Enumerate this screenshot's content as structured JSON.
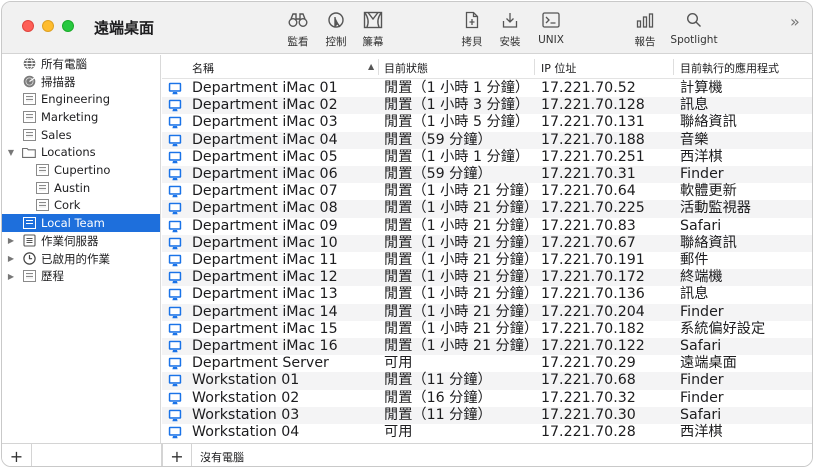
{
  "window": {
    "title": "遠端桌面"
  },
  "toolbar": {
    "buttons": [
      {
        "label": "監看",
        "icon": "binoculars-icon"
      },
      {
        "label": "控制",
        "icon": "control-cursor-icon"
      },
      {
        "label": "簾幕",
        "icon": "curtain-icon"
      },
      {
        "label": "拷貝",
        "icon": "copy-document-icon"
      },
      {
        "label": "安裝",
        "icon": "install-tray-icon"
      },
      {
        "label": "UNIX",
        "icon": "terminal-icon"
      },
      {
        "label": "報告",
        "icon": "report-bars-icon"
      },
      {
        "label": "Spotlight",
        "icon": "magnifier-icon"
      }
    ],
    "overflow_icon": "double-chevron-right-icon"
  },
  "sidebar": {
    "items": [
      {
        "label": "所有電腦",
        "icon": "network-globe-icon"
      },
      {
        "label": "掃描器",
        "icon": "scanner-radar-icon"
      },
      {
        "label": "Engineering",
        "icon": "computer-list-icon"
      },
      {
        "label": "Marketing",
        "icon": "computer-list-icon"
      },
      {
        "label": "Sales",
        "icon": "computer-list-icon"
      },
      {
        "label": "Locations",
        "icon": "folder-icon",
        "expanded": true
      },
      {
        "label": "Cupertino",
        "icon": "computer-list-icon"
      },
      {
        "label": "Austin",
        "icon": "computer-list-icon"
      },
      {
        "label": "Cork",
        "icon": "computer-list-icon"
      },
      {
        "label": "Local Team",
        "icon": "computer-list-icon",
        "selected": true
      },
      {
        "label": "作業伺服器",
        "icon": "task-server-icon",
        "expanded": false
      },
      {
        "label": "已啟用的作業",
        "icon": "clock-tasks-icon",
        "expanded": false
      },
      {
        "label": "歷程",
        "icon": "history-list-icon",
        "expanded": false
      }
    ]
  },
  "table": {
    "columns": [
      "名稱",
      "目前狀態",
      "IP 位址",
      "目前執行的應用程式"
    ],
    "sorted_column": "名稱",
    "rows": [
      {
        "name": "Department iMac 01",
        "status": "閒置（1 小時 1 分鐘）",
        "ip": "17.221.70.52",
        "app": "計算機"
      },
      {
        "name": "Department iMac 02",
        "status": "閒置（1 小時 3 分鐘）",
        "ip": "17.221.70.128",
        "app": "訊息"
      },
      {
        "name": "Department iMac 03",
        "status": "閒置（1 小時 5 分鐘）",
        "ip": "17.221.70.131",
        "app": "聯絡資訊"
      },
      {
        "name": "Department iMac 04",
        "status": "閒置（59 分鐘）",
        "ip": "17.221.70.188",
        "app": "音樂"
      },
      {
        "name": "Department iMac 05",
        "status": "閒置（1 小時 1 分鐘）",
        "ip": "17.221.70.251",
        "app": "西洋棋"
      },
      {
        "name": "Department iMac 06",
        "status": "閒置（59 分鐘）",
        "ip": "17.221.70.31",
        "app": "Finder"
      },
      {
        "name": "Department iMac 07",
        "status": "閒置（1 小時 21 分鐘）",
        "ip": "17.221.70.64",
        "app": "軟體更新"
      },
      {
        "name": "Department iMac 08",
        "status": "閒置（1 小時 21 分鐘）",
        "ip": "17.221.70.225",
        "app": "活動監視器"
      },
      {
        "name": "Department iMac 09",
        "status": "閒置（1 小時 21 分鐘）",
        "ip": "17.221.70.83",
        "app": "Safari"
      },
      {
        "name": "Department iMac 10",
        "status": "閒置（1 小時 21 分鐘）",
        "ip": "17.221.70.67",
        "app": "聯絡資訊"
      },
      {
        "name": "Department iMac 11",
        "status": "閒置（1 小時 21 分鐘）",
        "ip": "17.221.70.191",
        "app": "郵件"
      },
      {
        "name": "Department iMac 12",
        "status": "閒置（1 小時 21 分鐘）",
        "ip": "17.221.70.172",
        "app": "終端機"
      },
      {
        "name": "Department iMac 13",
        "status": "閒置（1 小時 21 分鐘）",
        "ip": "17.221.70.136",
        "app": "訊息"
      },
      {
        "name": "Department iMac 14",
        "status": "閒置（1 小時 21 分鐘）",
        "ip": "17.221.70.204",
        "app": "Finder"
      },
      {
        "name": "Department iMac 15",
        "status": "閒置（1 小時 21 分鐘）",
        "ip": "17.221.70.182",
        "app": "系統偏好設定"
      },
      {
        "name": "Department iMac 16",
        "status": "閒置（1 小時 21 分鐘）",
        "ip": "17.221.70.122",
        "app": "Safari"
      },
      {
        "name": "Department Server",
        "status": "可用",
        "ip": "17.221.70.29",
        "app": "遠端桌面"
      },
      {
        "name": "Workstation 01",
        "status": "閒置（11 分鐘）",
        "ip": "17.221.70.68",
        "app": "Finder"
      },
      {
        "name": "Workstation 02",
        "status": "閒置（16 分鐘）",
        "ip": "17.221.70.32",
        "app": "Finder"
      },
      {
        "name": "Workstation 03",
        "status": "閒置（11 分鐘）",
        "ip": "17.221.70.30",
        "app": "Safari"
      },
      {
        "name": "Workstation 04",
        "status": "可用",
        "ip": "17.221.70.28",
        "app": "西洋棋"
      }
    ]
  },
  "bottombar": {
    "add_sidebar_label": "+",
    "add_table_label": "+",
    "status": "沒有電腦"
  },
  "colors": {
    "selection": "#1e6fdc",
    "monitor_icon": "#1a73e8",
    "close": "#fe5f57",
    "minimize": "#febc2e",
    "zoom": "#28c840"
  }
}
